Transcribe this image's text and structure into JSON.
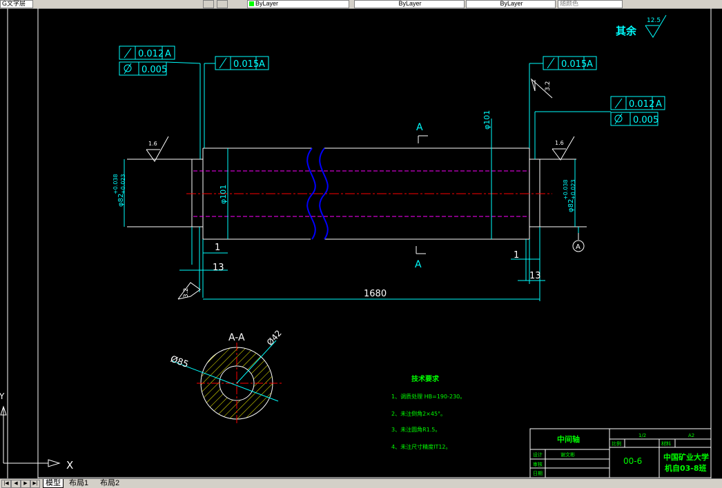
{
  "toolbar": {
    "text_style": "G文字层",
    "color": "ByLayer",
    "linetype": "ByLayer",
    "lineweight": "ByLayer",
    "plotstyle": "随颜色"
  },
  "tabs": [
    "模型",
    "布局1",
    "布局2"
  ],
  "ucs": {
    "x_label": "X",
    "y_label": "Y"
  },
  "drawing": {
    "roughness_other_label": "其余",
    "roughness_other_value": "12.5",
    "fcf_left_1": {
      "symbol": "runout",
      "value": "0.012",
      "datum": "A"
    },
    "fcf_left_2": {
      "symbol": "cylindricity",
      "value": "0.005"
    },
    "fcf_left_3": {
      "symbol": "runout",
      "value": "0.015",
      "datum": "A"
    },
    "fcf_right_1": {
      "symbol": "runout",
      "value": "0.015",
      "datum": "A"
    },
    "fcf_right_2": {
      "symbol": "runout",
      "value": "0.012",
      "datum": "A"
    },
    "fcf_right_3": {
      "symbol": "cylindricity",
      "value": "0.005"
    },
    "roughness_left": "1.6",
    "roughness_right": "1.6",
    "roughness_32_top": "3.2",
    "roughness_32_bottom": "3.2",
    "dia_left": "φ82",
    "dia_left_tol_upper": "+0.038",
    "dia_left_tol_lower": "+0.023",
    "dia_right": "φ82",
    "dia_right_tol_upper": "+0.038",
    "dia_right_tol_lower": "+0.023",
    "dia_body": "φ101",
    "dia_body_top": "φ101",
    "dim_1_left": "1",
    "dim_13_left": "13",
    "dim_1_right": "1",
    "dim_13_right": "13",
    "dim_length": "1680",
    "section_mark": "A",
    "section_mark_bottom": "A",
    "datum_label": "A",
    "section_title": "A-A",
    "section_outer_dia": "Ø85",
    "section_inner_dia": "Ø42"
  },
  "tech_requirements": {
    "title": "技术要求",
    "items": [
      "1、调质处理 HB=190-230。",
      "2、未注倒角2×45°。",
      "3、未注圆角R1.5。",
      "4、未注尺寸精度IT12。"
    ]
  },
  "title_block": {
    "part_name": "中间轴",
    "scale_value": "1/2",
    "sheet_value": "A2",
    "label_scale": "比例",
    "label_material": "材料",
    "drawing_number": "00-6",
    "designer_label": "设计",
    "designer_name": "谢文彬",
    "checker_label": "审核",
    "date_label": "日期",
    "university": "中国矿业大学",
    "class_name": "机自03-8班"
  }
}
